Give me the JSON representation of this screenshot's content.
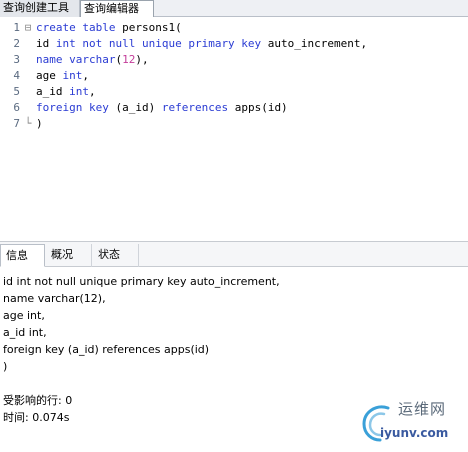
{
  "tabs": {
    "query_builder": "查询创建工具",
    "query_editor": "查询编辑器"
  },
  "editor": {
    "lines": [
      {
        "n": "1",
        "fold": "⊟",
        "parts": [
          [
            "kw",
            "create table "
          ],
          [
            "plain",
            "persons1("
          ]
        ]
      },
      {
        "n": "2",
        "fold": "",
        "parts": [
          [
            "plain",
            "id "
          ],
          [
            "kw",
            "int not null unique primary key "
          ],
          [
            "plain",
            "auto_increment,"
          ]
        ]
      },
      {
        "n": "3",
        "fold": "",
        "parts": [
          [
            "kw",
            "name varchar"
          ],
          [
            "plain",
            "("
          ],
          [
            "num",
            "12"
          ],
          [
            "plain",
            "),"
          ]
        ]
      },
      {
        "n": "4",
        "fold": "",
        "parts": [
          [
            "plain",
            "age "
          ],
          [
            "kw",
            "int"
          ],
          [
            "plain",
            ","
          ]
        ]
      },
      {
        "n": "5",
        "fold": "",
        "parts": [
          [
            "plain",
            "a_id "
          ],
          [
            "kw",
            "int"
          ],
          [
            "plain",
            ","
          ]
        ]
      },
      {
        "n": "6",
        "fold": "",
        "parts": [
          [
            "kw",
            "foreign key "
          ],
          [
            "plain",
            "(a_id) "
          ],
          [
            "kw",
            "references "
          ],
          [
            "plain",
            "apps(id)"
          ]
        ]
      },
      {
        "n": "7",
        "fold": "└",
        "parts": [
          [
            "plain",
            ")"
          ]
        ]
      }
    ]
  },
  "panel_tabs": {
    "info": "信息",
    "overview": "概况",
    "status": "状态"
  },
  "messages": [
    "id int not null unique primary key auto_increment,",
    "name varchar(12),",
    "age int,",
    "a_id int,",
    "foreign key (a_id) references apps(id)",
    ")",
    "",
    "受影响的行: 0",
    "时间: 0.074s"
  ],
  "watermark": {
    "cn": "运维网",
    "url": "iyunv.com"
  },
  "colors": {
    "keyword": "#2a3bd3",
    "number": "#c43d9a",
    "line_number": "#5a6a80"
  }
}
